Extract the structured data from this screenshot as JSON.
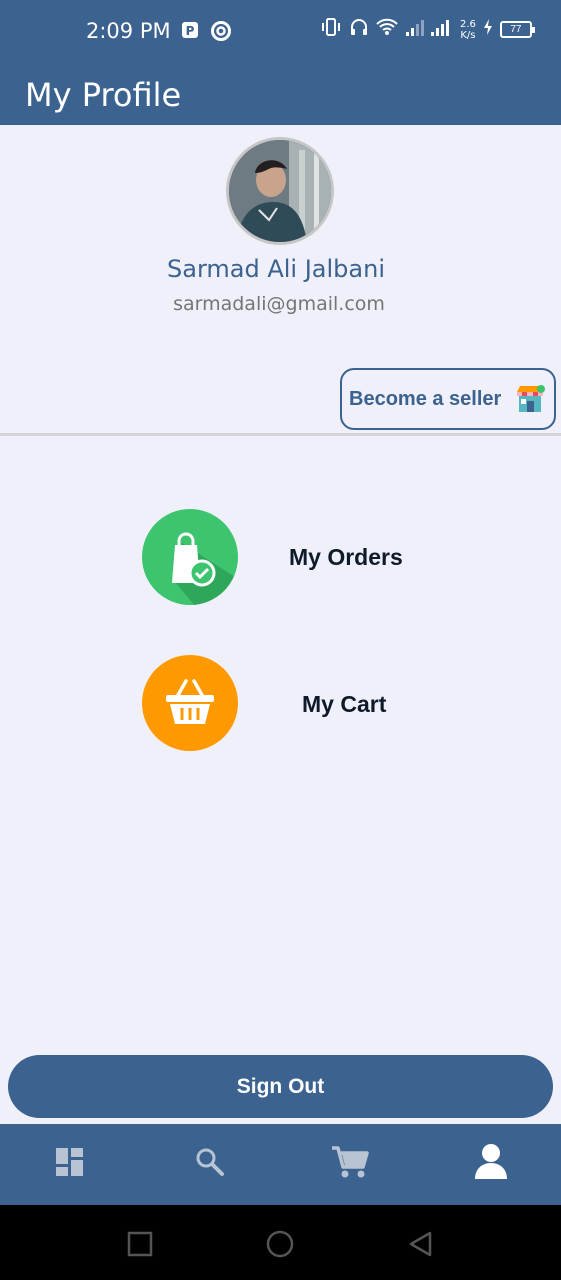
{
  "status_bar": {
    "time": "2:09 PM",
    "net_speed_value": "2.6",
    "net_speed_unit": "K/s",
    "battery": "77",
    "icons": [
      "parking-icon",
      "at-icon",
      "vibrate-icon",
      "headphones-icon",
      "wifi-icon",
      "signal-icon",
      "charging-icon",
      "battery-icon"
    ]
  },
  "header": {
    "title": "My Profile"
  },
  "profile": {
    "name": "Sarmad Ali Jalbani",
    "email": "sarmadali@gmail.com"
  },
  "seller": {
    "label": "Become a seller",
    "icon": "shop-icon"
  },
  "menu": [
    {
      "label": "My Orders",
      "icon": "shopping-bag-check-icon",
      "color": "#3dc46e"
    },
    {
      "label": "My Cart",
      "icon": "basket-icon",
      "color": "#ff9900"
    }
  ],
  "sign_out": {
    "label": "Sign Out"
  },
  "bottom_nav": [
    {
      "icon": "dashboard-icon",
      "active": false
    },
    {
      "icon": "search-icon",
      "active": false
    },
    {
      "icon": "cart-icon",
      "active": false
    },
    {
      "icon": "profile-icon",
      "active": true
    }
  ],
  "colors": {
    "primary": "#3c628f",
    "background": "#eff0fa",
    "orders": "#3dc46e",
    "cart": "#ff9900",
    "nav_inactive": "#b9c4d3"
  }
}
